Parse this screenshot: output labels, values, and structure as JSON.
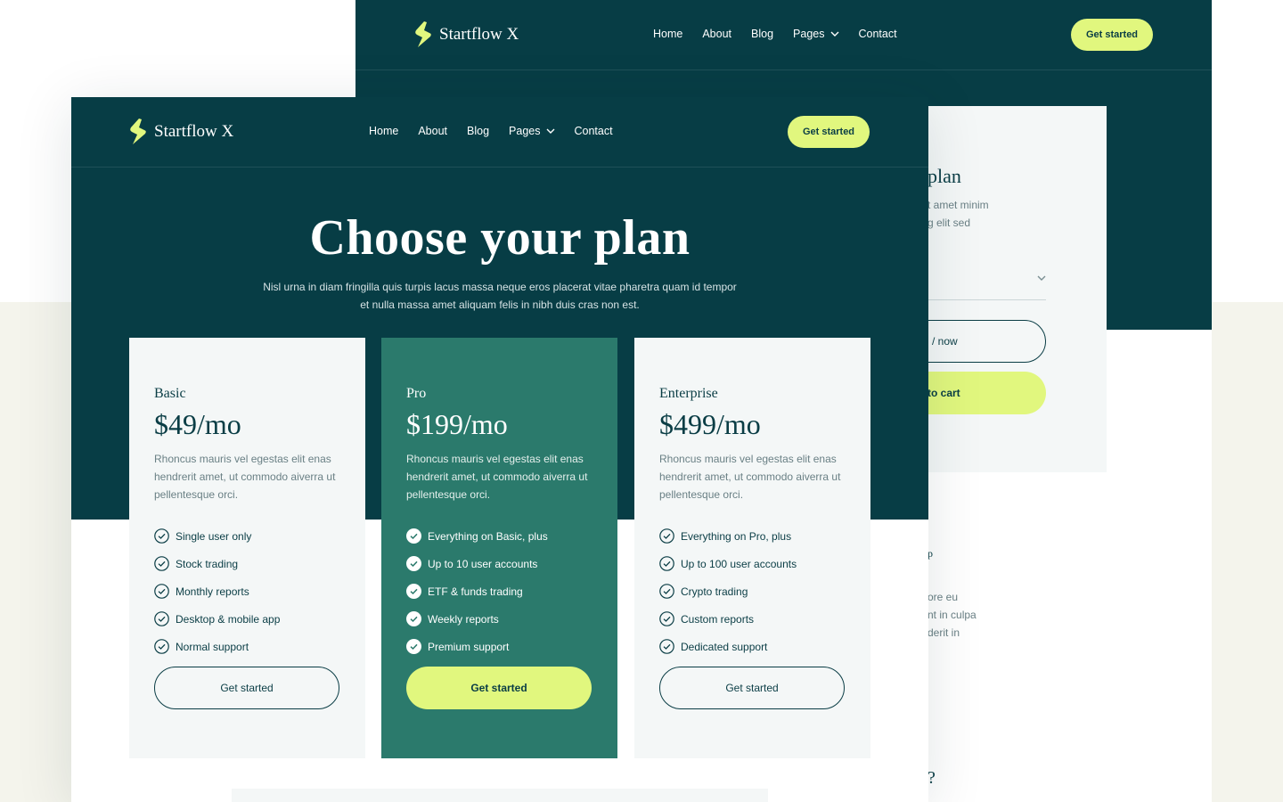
{
  "colors": {
    "dark_teal": "#073d45",
    "pro_green": "#2b7a6c",
    "lime": "#e1f77e",
    "card_bg": "#f4f7f7",
    "cream": "#f4f4ec"
  },
  "brand": {
    "name": "Startflow X",
    "logo_icon": "bolt-s-icon"
  },
  "nav": {
    "items": [
      "Home",
      "About",
      "Blog",
      "Pages",
      "Contact"
    ],
    "pages_icon": "chevron-down-icon",
    "cta": "Get started"
  },
  "back_window": {
    "card_title": "plan",
    "card_sub_line1": "t amet minim",
    "card_sub_line2": "g elit sed",
    "select_icon": "chevron-down-icon",
    "buy_now": "/ now",
    "add_to_cart": "to cart",
    "text_line1": "ore eu",
    "text_line2": "nt in culpa",
    "text_line3": "derit in",
    "heading_fragment": "p",
    "question_fragment": "?"
  },
  "hero": {
    "title": "Choose your plan",
    "subtitle": "Nisl urna in diam fringilla quis turpis lacus massa neque eros placerat vitae pharetra quam id tempor et nulla massa amet aliquam felis in nibh duis cras non est."
  },
  "plans": [
    {
      "name": "Basic",
      "price": "$49/mo",
      "description": "Rhoncus mauris vel egestas elit enas hendrerit amet, ut commodo aiverra ut pellentesque orci.",
      "features": [
        "Single user only",
        "Stock trading",
        "Monthly reports",
        "Desktop & mobile app",
        "Normal support"
      ],
      "cta": "Get started"
    },
    {
      "name": "Pro",
      "price": "$199/mo",
      "description": "Rhoncus mauris vel egestas elit enas hendrerit amet, ut commodo aiverra ut pellentesque orci.",
      "features": [
        "Everything on Basic, plus",
        "Up to 10 user accounts",
        "ETF & funds trading",
        "Weekly reports",
        "Premium support"
      ],
      "cta": "Get started"
    },
    {
      "name": "Enterprise",
      "price": "$499/mo",
      "description": "Rhoncus mauris vel egestas elit enas hendrerit amet, ut commodo aiverra ut pellentesque orci.",
      "features": [
        "Everything on Pro, plus",
        "Up to 100 user accounts",
        "Crypto trading",
        "Custom reports",
        "Dedicated support"
      ],
      "cta": "Get started"
    }
  ]
}
